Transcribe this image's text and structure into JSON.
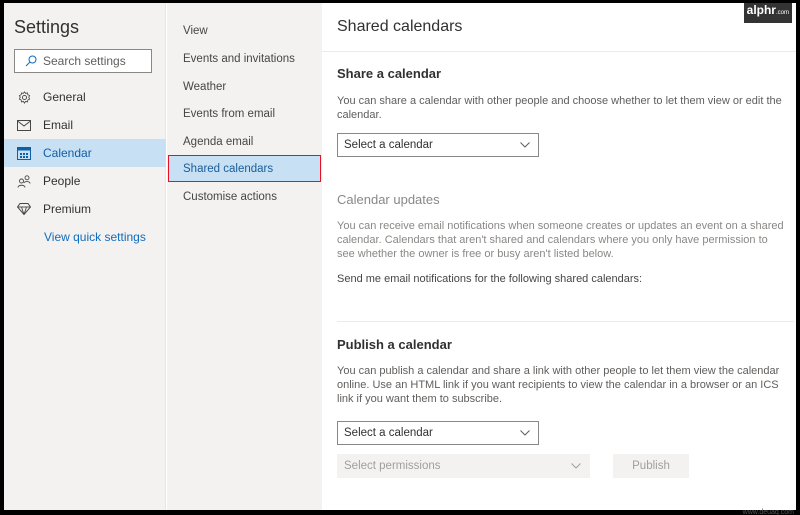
{
  "sidebar": {
    "title": "Settings",
    "search_placeholder": "Search settings",
    "items": [
      {
        "label": "General",
        "icon": "gear-icon"
      },
      {
        "label": "Email",
        "icon": "envelope-icon"
      },
      {
        "label": "Calendar",
        "icon": "calendar-icon",
        "active": true
      },
      {
        "label": "People",
        "icon": "people-icon"
      },
      {
        "label": "Premium",
        "icon": "diamond-icon"
      }
    ],
    "quick_settings_link": "View quick settings"
  },
  "subnav": {
    "items": [
      {
        "label": "View"
      },
      {
        "label": "Events and invitations"
      },
      {
        "label": "Weather"
      },
      {
        "label": "Events from email"
      },
      {
        "label": "Agenda email"
      },
      {
        "label": "Shared calendars",
        "active": true
      },
      {
        "label": "Customise actions"
      }
    ]
  },
  "main": {
    "title": "Shared calendars",
    "share": {
      "heading": "Share a calendar",
      "description": "You can share a calendar with other people and choose whether to let them view or edit the calendar.",
      "select_value": "Select a calendar"
    },
    "updates": {
      "heading": "Calendar updates",
      "description": "You can receive email notifications when someone creates or updates an event on a shared calendar. Calendars that aren't shared and calendars where you only have permission to see whether the owner is free or busy aren't listed below.",
      "notify_label": "Send me email notifications for the following shared calendars:"
    },
    "publish": {
      "heading": "Publish a calendar",
      "description": "You can publish a calendar and share a link with other people to let them view the calendar online. Use an HTML link if you want recipients to view the calendar in a browser or an ICS link if you want them to subscribe.",
      "select_calendar_value": "Select a calendar",
      "select_permissions_value": "Select permissions",
      "publish_button": "Publish"
    }
  },
  "watermarks": {
    "top": "alphr",
    "top_suffix": ".com",
    "bottom": "www.deuaq.com"
  },
  "colors": {
    "accent": "#0f6cbd",
    "selected_bg": "#c7e0f4",
    "highlight_outline": "#e81123"
  }
}
